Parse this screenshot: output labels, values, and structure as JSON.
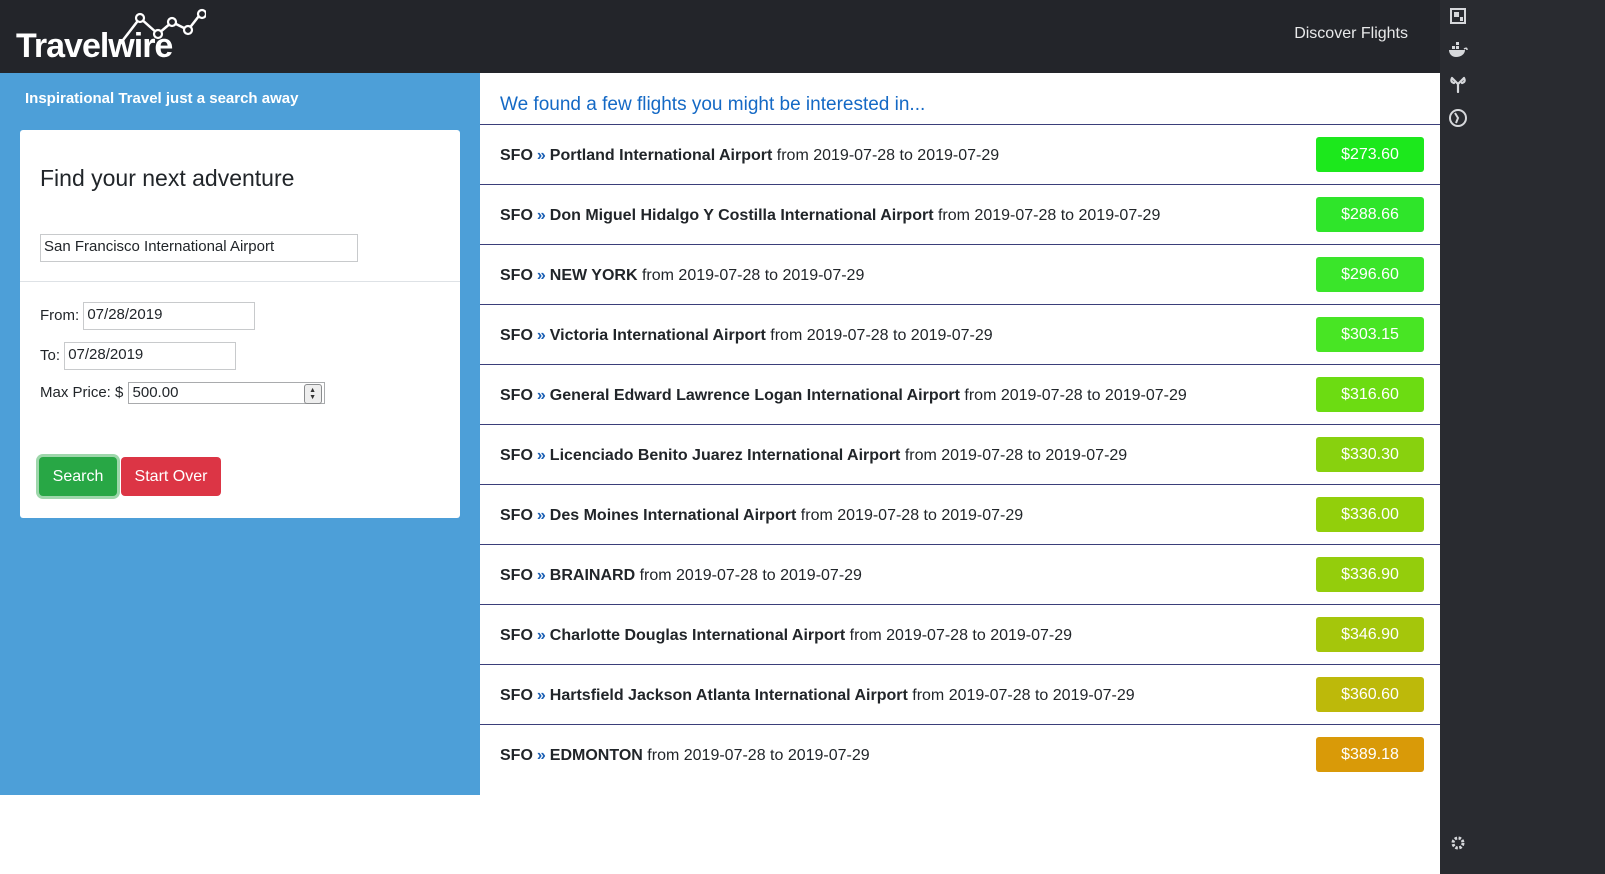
{
  "header": {
    "logo_text": "Travelwire",
    "nav_link": "Discover Flights"
  },
  "sidebar_icons": [
    "app-frame-icon",
    "docker-icon",
    "branch-icon",
    "clock-icon",
    "gear-icon"
  ],
  "search_panel": {
    "tagline": "Inspirational Travel just a search away",
    "title": "Find your next adventure",
    "airport_value": "San Francisco International Airport",
    "from_label": "From:",
    "from_value": "07/28/2019",
    "to_label": "To:",
    "to_value": "07/28/2019",
    "max_price_label": "Max Price: $",
    "max_price_value": "500.00",
    "search_label": "Search",
    "start_over_label": "Start Over"
  },
  "results": {
    "heading": "We found a few flights you might be interested in...",
    "items": [
      {
        "origin": "SFO",
        "destination": "Portland International Airport",
        "dates": "from 2019-07-28 to 2019-07-29",
        "price": "$273.60",
        "color": "#1ce81c"
      },
      {
        "origin": "SFO",
        "destination": "Don Miguel Hidalgo Y Costilla International Airport",
        "dates": "from 2019-07-28 to 2019-07-29",
        "price": "$288.66",
        "color": "#2fe52a"
      },
      {
        "origin": "SFO",
        "destination": "NEW YORK",
        "dates": "from 2019-07-28 to 2019-07-29",
        "price": "$296.60",
        "color": "#3ae52a"
      },
      {
        "origin": "SFO",
        "destination": "Victoria International Airport",
        "dates": "from 2019-07-28 to 2019-07-29",
        "price": "$303.15",
        "color": "#48e524"
      },
      {
        "origin": "SFO",
        "destination": "General Edward Lawrence Logan International Airport",
        "dates": "from 2019-07-28 to 2019-07-29",
        "price": "$316.60",
        "color": "#6cdc12"
      },
      {
        "origin": "SFO",
        "destination": "Licenciado Benito Juarez International Airport",
        "dates": "from 2019-07-28 to 2019-07-29",
        "price": "$330.30",
        "color": "#88d10e"
      },
      {
        "origin": "SFO",
        "destination": "Des Moines International Airport",
        "dates": "from 2019-07-28 to 2019-07-29",
        "price": "$336.00",
        "color": "#92cf0b"
      },
      {
        "origin": "SFO",
        "destination": "BRAINARD",
        "dates": "from 2019-07-28 to 2019-07-29",
        "price": "$336.90",
        "color": "#94cd0c"
      },
      {
        "origin": "SFO",
        "destination": "Charlotte Douglas International Airport",
        "dates": "from 2019-07-28 to 2019-07-29",
        "price": "$346.90",
        "color": "#a5c60b"
      },
      {
        "origin": "SFO",
        "destination": "Hartsfield Jackson Atlanta International Airport",
        "dates": "from 2019-07-28 to 2019-07-29",
        "price": "$360.60",
        "color": "#bdb90a"
      },
      {
        "origin": "SFO",
        "destination": "EDMONTON",
        "dates": "from 2019-07-28 to 2019-07-29",
        "price": "$389.18",
        "color": "#d99a08"
      }
    ]
  }
}
